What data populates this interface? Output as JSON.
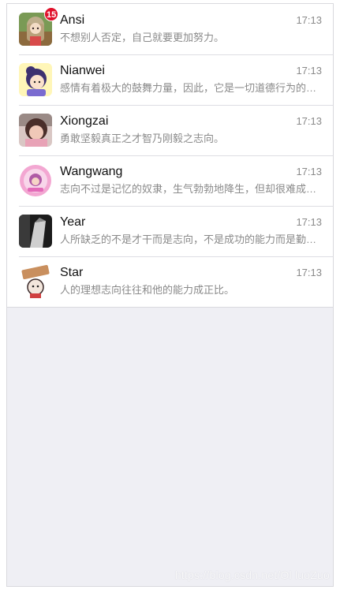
{
  "conversations": [
    {
      "name": "Ansi",
      "time": "17:13",
      "message": "不想别人否定，自己就要更加努力。",
      "badge": "15",
      "avatar_icon": "anime-girl-avatar-icon"
    },
    {
      "name": "Nianwei",
      "time": "17:13",
      "message": "感情有着极大的鼓舞力量，因此，它是一切道德行为的重要前提。",
      "avatar_icon": "cartoon-girl-avatar-icon"
    },
    {
      "name": "Xiongzai",
      "time": "17:13",
      "message": "勇敢坚毅真正之才智乃刚毅之志向。",
      "avatar_icon": "photo-girl-avatar-icon"
    },
    {
      "name": "Wangwang",
      "time": "17:13",
      "message": "志向不过是记忆的奴隶，生气勃勃地降生，但却很难成长。",
      "avatar_icon": "pink-circle-avatar-icon"
    },
    {
      "name": "Year",
      "time": "17:13",
      "message": "人所缺乏的不是才干而是志向，不是成功的能力而是勤劳的意志。",
      "avatar_icon": "dark-photo-avatar-icon"
    },
    {
      "name": "Star",
      "time": "17:13",
      "message": "人的理想志向往往和他的能力成正比。",
      "avatar_icon": "cartoon-sign-avatar-icon"
    }
  ],
  "watermark": "https://blog.csdn.net/Ol luoZuo"
}
